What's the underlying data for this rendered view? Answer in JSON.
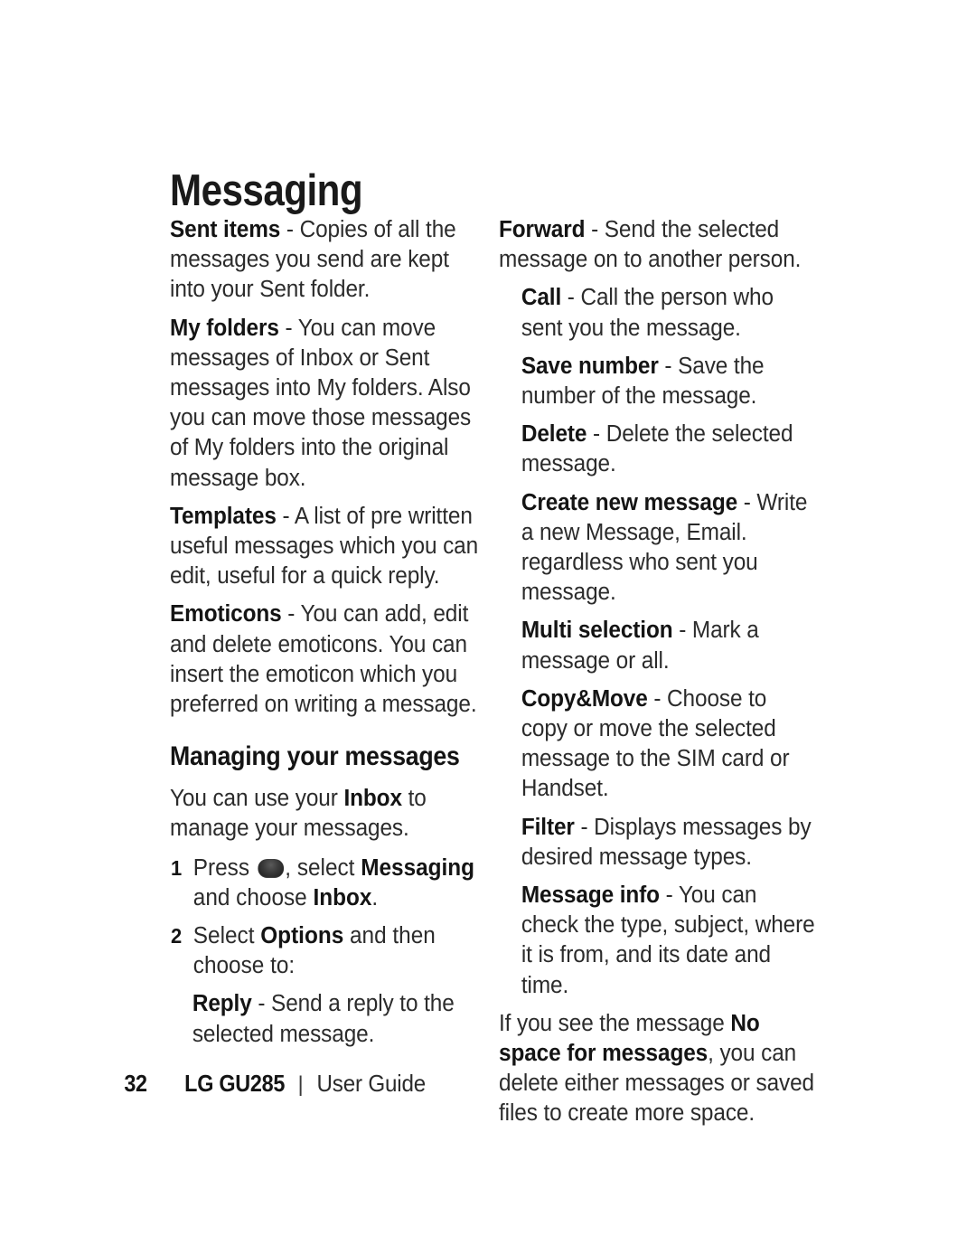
{
  "document": {
    "title": "Messaging"
  },
  "left_column": {
    "paragraphs": [
      {
        "term": "Sent items",
        "dash": " - ",
        "text": "Copies of all the messages you send are kept into your Sent folder.",
        "indent": false
      },
      {
        "term": "My folders",
        "dash": " - ",
        "text": "You can move messages of Inbox or Sent messages into My folders. Also you can move those messages of My folders into the original message box.",
        "indent": false
      },
      {
        "term": "Templates",
        "dash": " - ",
        "text": "A list of pre written useful messages which you can edit, useful for a quick reply.",
        "indent": false
      },
      {
        "term": "Emoticons",
        "dash": " - ",
        "text": "You can add, edit and delete emoticons. You can insert the emoticon which you preferred on writing a message.",
        "indent": false
      }
    ],
    "section_heading": "Managing your messages",
    "intro": {
      "before": "You can use your ",
      "bold": "Inbox",
      "after": " to manage your messages."
    },
    "steps": [
      {
        "number": "1",
        "before_icon": "Press ",
        "icon": "ok-key-icon",
        "after_icon": ", select ",
        "bold1": "Messaging",
        "middle": " and choose ",
        "bold2": "Inbox",
        "end": "."
      },
      {
        "number": "2",
        "before_icon": "Select ",
        "bold1": "Options",
        "middle": " and then choose to:",
        "bold2": "",
        "end": ""
      }
    ],
    "step_sub_paragraph": {
      "term": "Reply",
      "dash": " - ",
      "text": "Send a reply to the selected message."
    }
  },
  "right_column": {
    "paragraphs": [
      {
        "term": "Forward",
        "dash": " - ",
        "text": "Send the selected message on to another person.",
        "indent": false
      },
      {
        "term": "Call",
        "dash": " - ",
        "text": "Call the person who sent you the message.",
        "indent": true
      },
      {
        "term": "Save number",
        "dash": " - ",
        "text": "Save the number of the message.",
        "indent": true
      },
      {
        "term": "Delete",
        "dash": " - ",
        "text": "Delete the selected message.",
        "indent": true
      },
      {
        "term": "Create new message",
        "dash": " - ",
        "text": "Write a new Message, Email. regardless who sent you message.",
        "indent": true
      },
      {
        "term": "Multi selection",
        "dash": " - ",
        "text": "Mark a message or all.",
        "indent": true
      },
      {
        "term": "Copy&Move",
        "dash": " - ",
        "text": "Choose to copy or move the selected message to the SIM card or Handset.",
        "indent": true
      },
      {
        "term": "Filter",
        "dash": " - ",
        "text": "Displays messages by desired message types.",
        "indent": true
      },
      {
        "term": "Message info",
        "dash": " - ",
        "text": "You can check the type, subject, where it is from, and its date and time.",
        "indent": true
      }
    ],
    "closing_note": {
      "before": "If you see the message ",
      "bold": "No space for messages",
      "after": ", you can delete either messages or saved files to create more space."
    }
  },
  "footer": {
    "page_number": "32",
    "brand": "LG GU285",
    "separator": "|",
    "doc_type": "User Guide"
  }
}
